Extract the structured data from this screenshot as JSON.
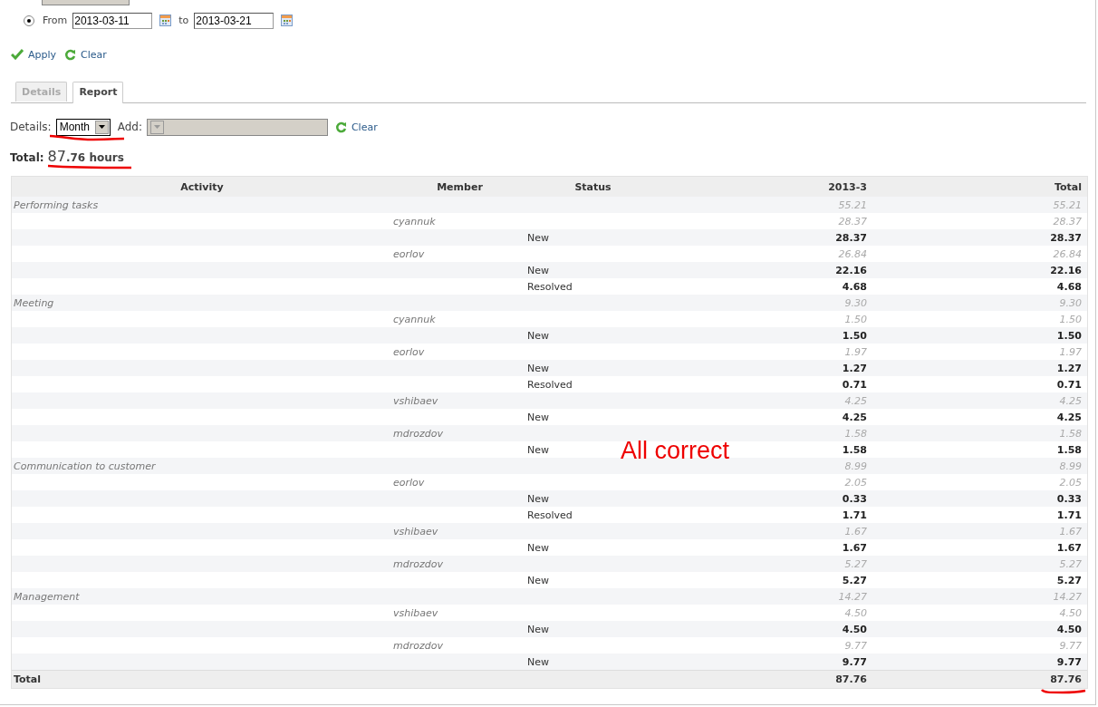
{
  "filter": {
    "radio_selected": true,
    "from_label": "From",
    "from_value": "2013-03-11",
    "to_label": "to",
    "to_value": "2013-03-21"
  },
  "actions": [
    {
      "kind": "apply",
      "label": "Apply"
    },
    {
      "kind": "clear",
      "label": "Clear"
    }
  ],
  "tabs": [
    {
      "label": "Details",
      "selected": false
    },
    {
      "label": "Report",
      "selected": true
    }
  ],
  "options": {
    "details_label": "Details:",
    "details_value": "Month",
    "add_label": "Add:",
    "add_disabled": true,
    "clear_label": "Clear"
  },
  "total": {
    "label": "Total:",
    "value_main": "87",
    "value_rest": ".76 hours"
  },
  "report": {
    "columns": [
      "Activity",
      "Member",
      "Status",
      "2013-3",
      "Total"
    ],
    "rows": [
      {
        "name": "Performing tasks",
        "month": "55.21",
        "total": "55.21",
        "children": [
          {
            "name": "cyannuk",
            "month": "28.37",
            "total": "28.37",
            "children": [
              {
                "name": "New",
                "month": "28.37",
                "total": "28.37"
              }
            ]
          },
          {
            "name": "eorlov",
            "month": "26.84",
            "total": "26.84",
            "children": [
              {
                "name": "New",
                "month": "22.16",
                "total": "22.16"
              },
              {
                "name": "Resolved",
                "month": "4.68",
                "total": "4.68"
              }
            ]
          }
        ]
      },
      {
        "name": "Meeting",
        "month": "9.30",
        "total": "9.30",
        "children": [
          {
            "name": "cyannuk",
            "month": "1.50",
            "total": "1.50",
            "children": [
              {
                "name": "New",
                "month": "1.50",
                "total": "1.50"
              }
            ]
          },
          {
            "name": "eorlov",
            "month": "1.97",
            "total": "1.97",
            "children": [
              {
                "name": "New",
                "month": "1.27",
                "total": "1.27"
              },
              {
                "name": "Resolved",
                "month": "0.71",
                "total": "0.71"
              }
            ]
          },
          {
            "name": "vshibaev",
            "month": "4.25",
            "total": "4.25",
            "children": [
              {
                "name": "New",
                "month": "4.25",
                "total": "4.25"
              }
            ]
          },
          {
            "name": "mdrozdov",
            "month": "1.58",
            "total": "1.58",
            "children": [
              {
                "name": "New",
                "month": "1.58",
                "total": "1.58"
              }
            ]
          }
        ]
      },
      {
        "name": "Communication to customer",
        "month": "8.99",
        "total": "8.99",
        "children": [
          {
            "name": "eorlov",
            "month": "2.05",
            "total": "2.05",
            "children": [
              {
                "name": "New",
                "month": "0.33",
                "total": "0.33"
              },
              {
                "name": "Resolved",
                "month": "1.71",
                "total": "1.71"
              }
            ]
          },
          {
            "name": "vshibaev",
            "month": "1.67",
            "total": "1.67",
            "children": [
              {
                "name": "New",
                "month": "1.67",
                "total": "1.67"
              }
            ]
          },
          {
            "name": "mdrozdov",
            "month": "5.27",
            "total": "5.27",
            "children": [
              {
                "name": "New",
                "month": "5.27",
                "total": "5.27"
              }
            ]
          }
        ]
      },
      {
        "name": "Management",
        "month": "14.27",
        "total": "14.27",
        "children": [
          {
            "name": "vshibaev",
            "month": "4.50",
            "total": "4.50",
            "children": [
              {
                "name": "New",
                "month": "4.50",
                "total": "4.50"
              }
            ]
          },
          {
            "name": "mdrozdov",
            "month": "9.77",
            "total": "9.77",
            "children": [
              {
                "name": "New",
                "month": "9.77",
                "total": "9.77"
              }
            ]
          }
        ]
      }
    ],
    "footer": {
      "label": "Total",
      "month": "87.76",
      "total": "87.76"
    }
  },
  "annotation": "All correct"
}
